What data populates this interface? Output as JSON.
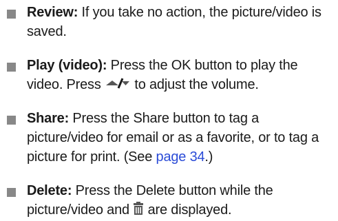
{
  "items": [
    {
      "term": "Review:",
      "text": " If you take no action, the picture/video is saved."
    },
    {
      "term": "Play (video):",
      "text_before": " Press the OK button to play the video. Press ",
      "icon": "up-down-arrows-icon",
      "text_after": " to adjust the volume."
    },
    {
      "term": "Share:",
      "text_before": " Press the Share button to tag a picture/video for email or as a favorite, or to tag a picture for print. (See ",
      "link": "page 34",
      "text_after": ".)"
    },
    {
      "term": "Delete:",
      "text_before": " Press the Delete button while the picture/video and ",
      "icon": "trash-icon",
      "text_after": " are displayed."
    }
  ],
  "colors": {
    "bullet": "#888888",
    "link": "#2a4bd7",
    "text": "#1a1a1a",
    "icon": "#555555"
  }
}
